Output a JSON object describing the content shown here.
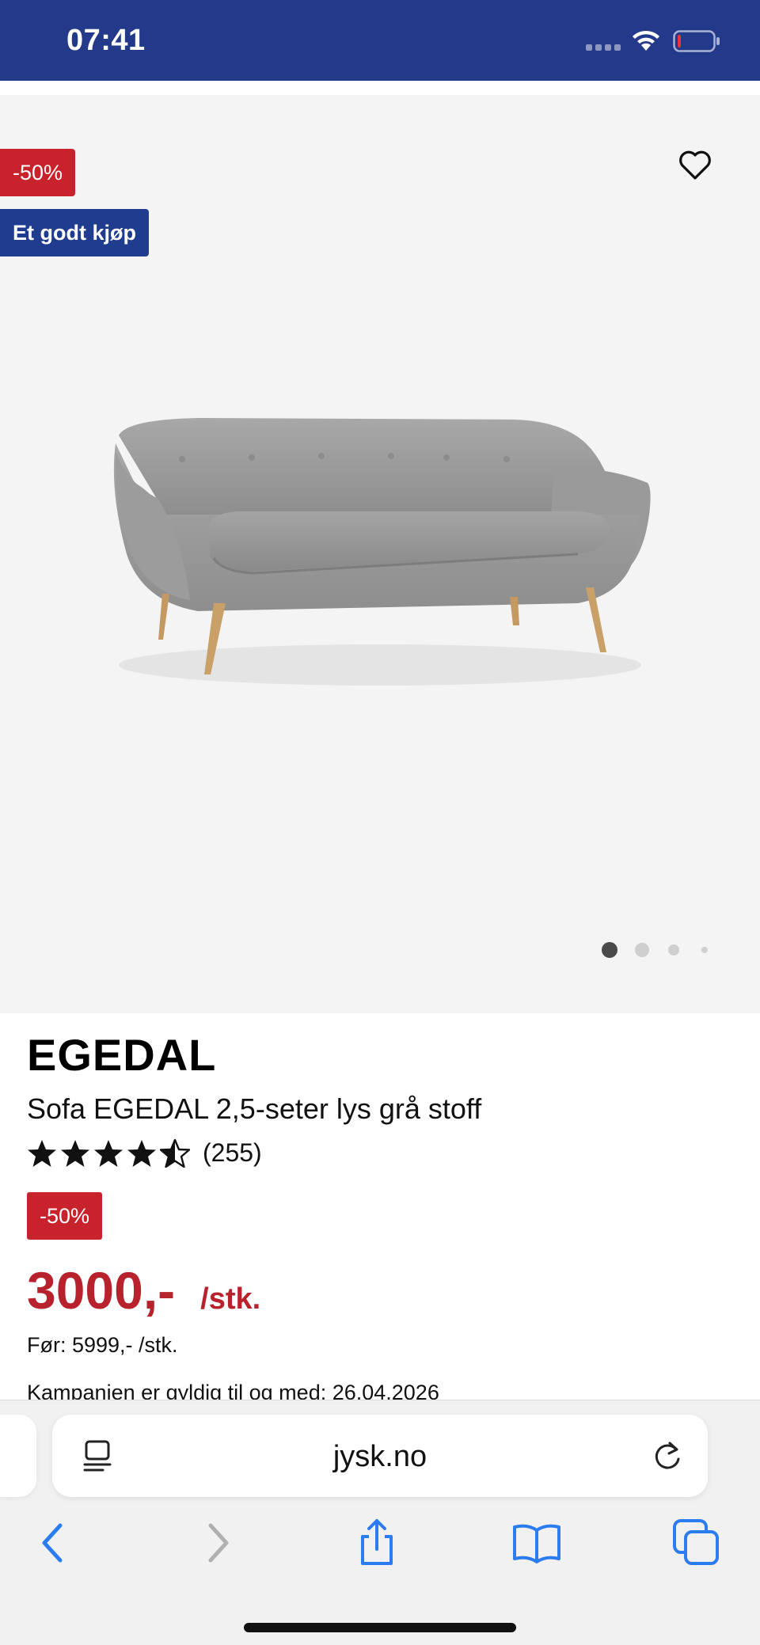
{
  "status_bar": {
    "time": "07:41",
    "colors": {
      "background": "#233a8a"
    }
  },
  "gallery": {
    "discount_badge": "-50%",
    "tag_badge": "Et godt kjøp",
    "favorite_icon": "heart-icon",
    "image": "grey-sofa-illustration",
    "pagination": {
      "count": 4,
      "active": 1
    }
  },
  "product": {
    "brand": "EGEDAL",
    "name": "Sofa EGEDAL 2,5-seter lys grå stoff",
    "rating": {
      "stars": 4.5,
      "max": 5,
      "count_label": "(255)"
    },
    "discount_badge": "-50%",
    "price": "3000,-",
    "price_unit": "/stk.",
    "before_price": "Før: 5999,- /stk.",
    "campaign_text": "Kampanjen er gyldig til og med: 26.04.2026",
    "colors": {
      "price": "#b8222c",
      "sale_badge": "#c8232c",
      "tag_badge": "#1f3c8e"
    }
  },
  "browser": {
    "url": "jysk.no",
    "icons": {
      "reader": "reader-mode-icon",
      "reload": "reload-icon",
      "back": "chevron-left-icon",
      "forward": "chevron-right-icon",
      "share": "share-icon",
      "bookmarks": "book-icon",
      "tabs": "tabs-icon"
    },
    "colors": {
      "accent": "#2b7cf0"
    }
  }
}
